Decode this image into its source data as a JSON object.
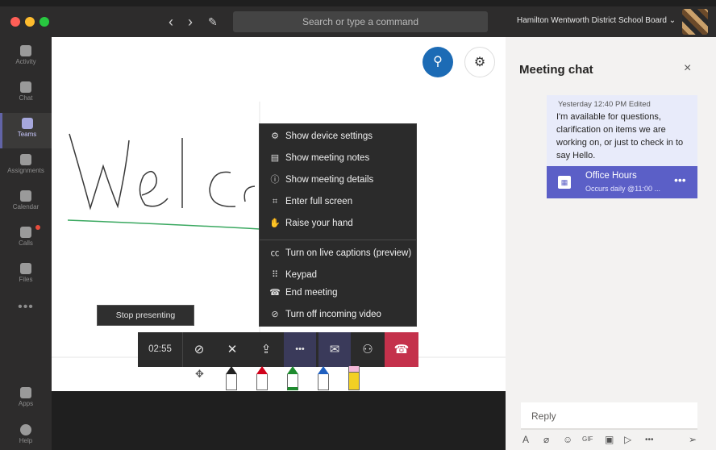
{
  "titlebar": {
    "back": "‹",
    "forward": "›",
    "compose": "✎",
    "search_placeholder": "Search or type a command",
    "org": "Hamilton Wentworth District School Board ⌄"
  },
  "rail": {
    "items": [
      {
        "label": "Activity"
      },
      {
        "label": "Chat"
      },
      {
        "label": "Teams"
      },
      {
        "label": "Assignments"
      },
      {
        "label": "Calendar"
      },
      {
        "label": "Calls"
      },
      {
        "label": "Files"
      }
    ],
    "more": "•••",
    "apps": "Apps",
    "help": "Help"
  },
  "stage": {
    "people_icon": "⚲",
    "settings_icon": "⚙",
    "whiteboard_text": "Welc"
  },
  "menu": {
    "items": [
      {
        "icon": "⚙",
        "label": "Show device settings"
      },
      {
        "icon": "▤",
        "label": "Show meeting notes"
      },
      {
        "icon": "ⓘ",
        "label": "Show meeting details"
      },
      {
        "icon": "⌗",
        "label": "Enter full screen"
      },
      {
        "icon": "✋",
        "label": "Raise your hand"
      },
      {
        "icon": "㏄",
        "label": "Turn on live captions (preview)"
      },
      {
        "icon": "⠿",
        "label": "Keypad"
      },
      {
        "icon": "☎",
        "label": "End meeting"
      },
      {
        "icon": "⊘",
        "label": "Turn off incoming video"
      }
    ]
  },
  "stop_presenting": "Stop presenting",
  "toolbar": {
    "timer": "02:55",
    "video_icon": "⊘",
    "mic_icon": "✕",
    "share_icon": "⇪",
    "more_icon": "•••",
    "chat_icon": "✉",
    "participants_icon": "⚇",
    "hangup_icon": "☎"
  },
  "pens": {
    "move_icon": "✥",
    "colors": [
      "#222222",
      "#d0021b",
      "#1e8a2e",
      "#1f5fbf",
      "#f2d024"
    ]
  },
  "chat": {
    "title": "Meeting chat",
    "close": "×",
    "message": {
      "meta": "Yesterday 12:40 PM   Edited",
      "text": "I'm available for questions, clarification on items we are working on, or just to check in to say Hello."
    },
    "card": {
      "icon": "▦",
      "title": "Office Hours",
      "subtitle": "Occurs daily @11:00 ...",
      "more": "•••"
    },
    "reply_placeholder": "Reply",
    "compose_icons": [
      "A",
      "⌀",
      "☺",
      "GIF",
      "▣",
      "▷",
      "•••",
      "➢"
    ]
  },
  "colors": {
    "accent": "#6264a7",
    "hangup": "#c4314b",
    "people_button": "#1c6bb5"
  }
}
